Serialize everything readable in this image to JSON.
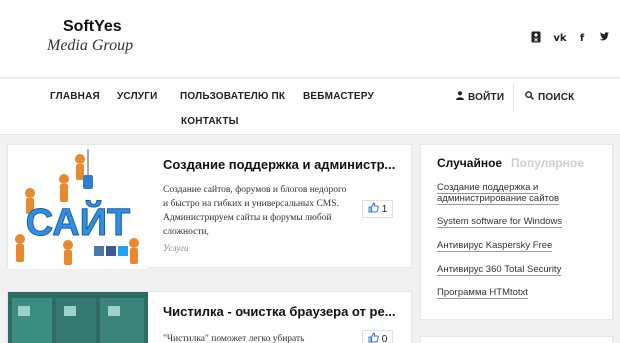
{
  "brand": {
    "name": "SoftYes",
    "subtitle": "Media Group"
  },
  "social": [
    {
      "name": "odnoklassniki",
      "glyph": "ok"
    },
    {
      "name": "vkontakte",
      "glyph": "vk"
    },
    {
      "name": "facebook",
      "glyph": "f"
    },
    {
      "name": "twitter",
      "glyph": "t"
    }
  ],
  "nav": {
    "items": [
      "ГЛАВНАЯ",
      "УСЛУГИ",
      "ПОЛЬЗОВАТЕЛЮ ПК",
      "ВЕБМАСТЕРУ",
      "КОНТАКТЫ"
    ],
    "login_label": "ВОЙТИ",
    "search_label": "ПОИСК"
  },
  "articles": [
    {
      "title": "Создание поддержка и администр...",
      "excerpt": "Создание сайтов, форумов и блогов недорого и быстро на гибких и универсальных CMS. Администрируем сайты и форумы любой сложности,",
      "category": "Услуги",
      "likes": "1",
      "thumb_text": "САЙТ"
    },
    {
      "title": "Чистилка - очистка браузера от ре...",
      "excerpt": "\"Чистилка\" поможет легко убирать",
      "likes": "0"
    }
  ],
  "sidebar": {
    "tab_active": "Случайное",
    "tab_inactive": "Популярное",
    "links": [
      "Создание поддержка и администрирование сайтов",
      "System software for Windows",
      "Антивирус Kaspersky Free",
      "Антивирус 360 Total Security",
      "Программа HTMtotxt"
    ]
  },
  "colors": {
    "accent_blue": "#3b76c9",
    "background": "#f1f1f1"
  }
}
